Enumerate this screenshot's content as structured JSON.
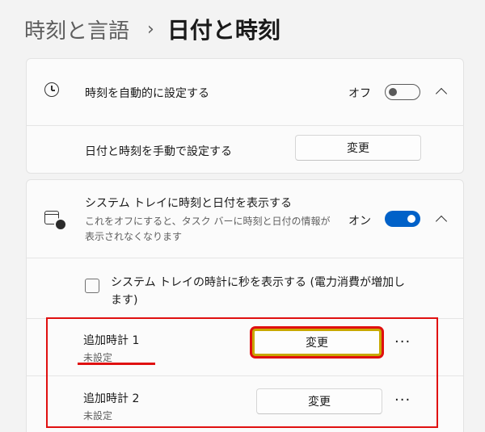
{
  "breadcrumb": {
    "parent": "時刻と言語",
    "separator": "›",
    "current": "日付と時刻"
  },
  "auto_time": {
    "icon": "clock-icon",
    "label": "時刻を自動的に設定する",
    "toggle_state_text": "オフ",
    "toggle_on": false
  },
  "manual_time": {
    "label": "日付と時刻を手動で設定する",
    "button_label": "変更"
  },
  "tray_display": {
    "icon": "calendar-clock-icon",
    "label": "システム トレイに時刻と日付を表示する",
    "description_line1": "これをオフにすると、タスク バーに時刻と日付の情報が",
    "description_line2": "表示されなくなります",
    "toggle_state_text": "オン",
    "toggle_on": true,
    "accent_color": "#0061c8"
  },
  "seconds_option": {
    "checked": false,
    "label_line1": "システム トレイの時計に秒を表示する (電力消費が増加し",
    "label_line2": "ます)"
  },
  "additional_clocks": [
    {
      "label": "追加時計 1",
      "status": "未設定",
      "button_label": "変更",
      "more_label": "···"
    },
    {
      "label": "追加時計 2",
      "status": "未設定",
      "button_label": "変更",
      "more_label": "···"
    }
  ],
  "annotation_colors": {
    "highlight_border": "#e01010",
    "button_highlight": "#c8a800"
  }
}
